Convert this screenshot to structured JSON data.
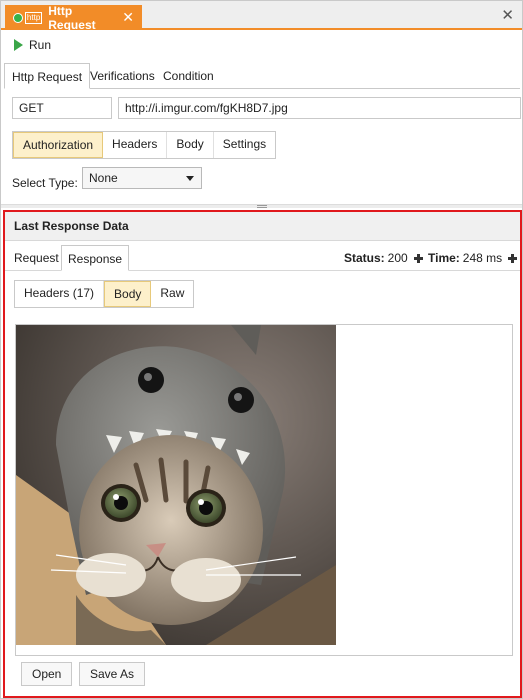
{
  "doc_tab": {
    "badge": "http",
    "title": "Http Request",
    "close": "✕"
  },
  "window": {
    "close": "✕"
  },
  "toolbar": {
    "run_label": "Run"
  },
  "request_tabs": [
    "Http Request",
    "Verifications",
    "Condition"
  ],
  "request": {
    "method": "GET",
    "url": "http://i.imgur.com/fgKH8D7.jpg"
  },
  "config_tabs": [
    "Authorization",
    "Headers",
    "Body",
    "Settings"
  ],
  "auth": {
    "select_type_label": "Select Type:",
    "select_type_value": "None"
  },
  "response": {
    "panel_title": "Last Response Data",
    "tabs": [
      "Request",
      "Response"
    ],
    "status_label": "Status:",
    "status_value": "200",
    "time_label": "Time:",
    "time_value": "248 ms",
    "view_tabs": [
      "Headers (17)",
      "Body",
      "Raw"
    ],
    "open_label": "Open",
    "save_as_label": "Save As"
  },
  "colors": {
    "accent": "#f28c28",
    "run_green": "#3aa648",
    "highlight_border": "#e0191d",
    "active_tab_fill": "#fdf0cb"
  }
}
